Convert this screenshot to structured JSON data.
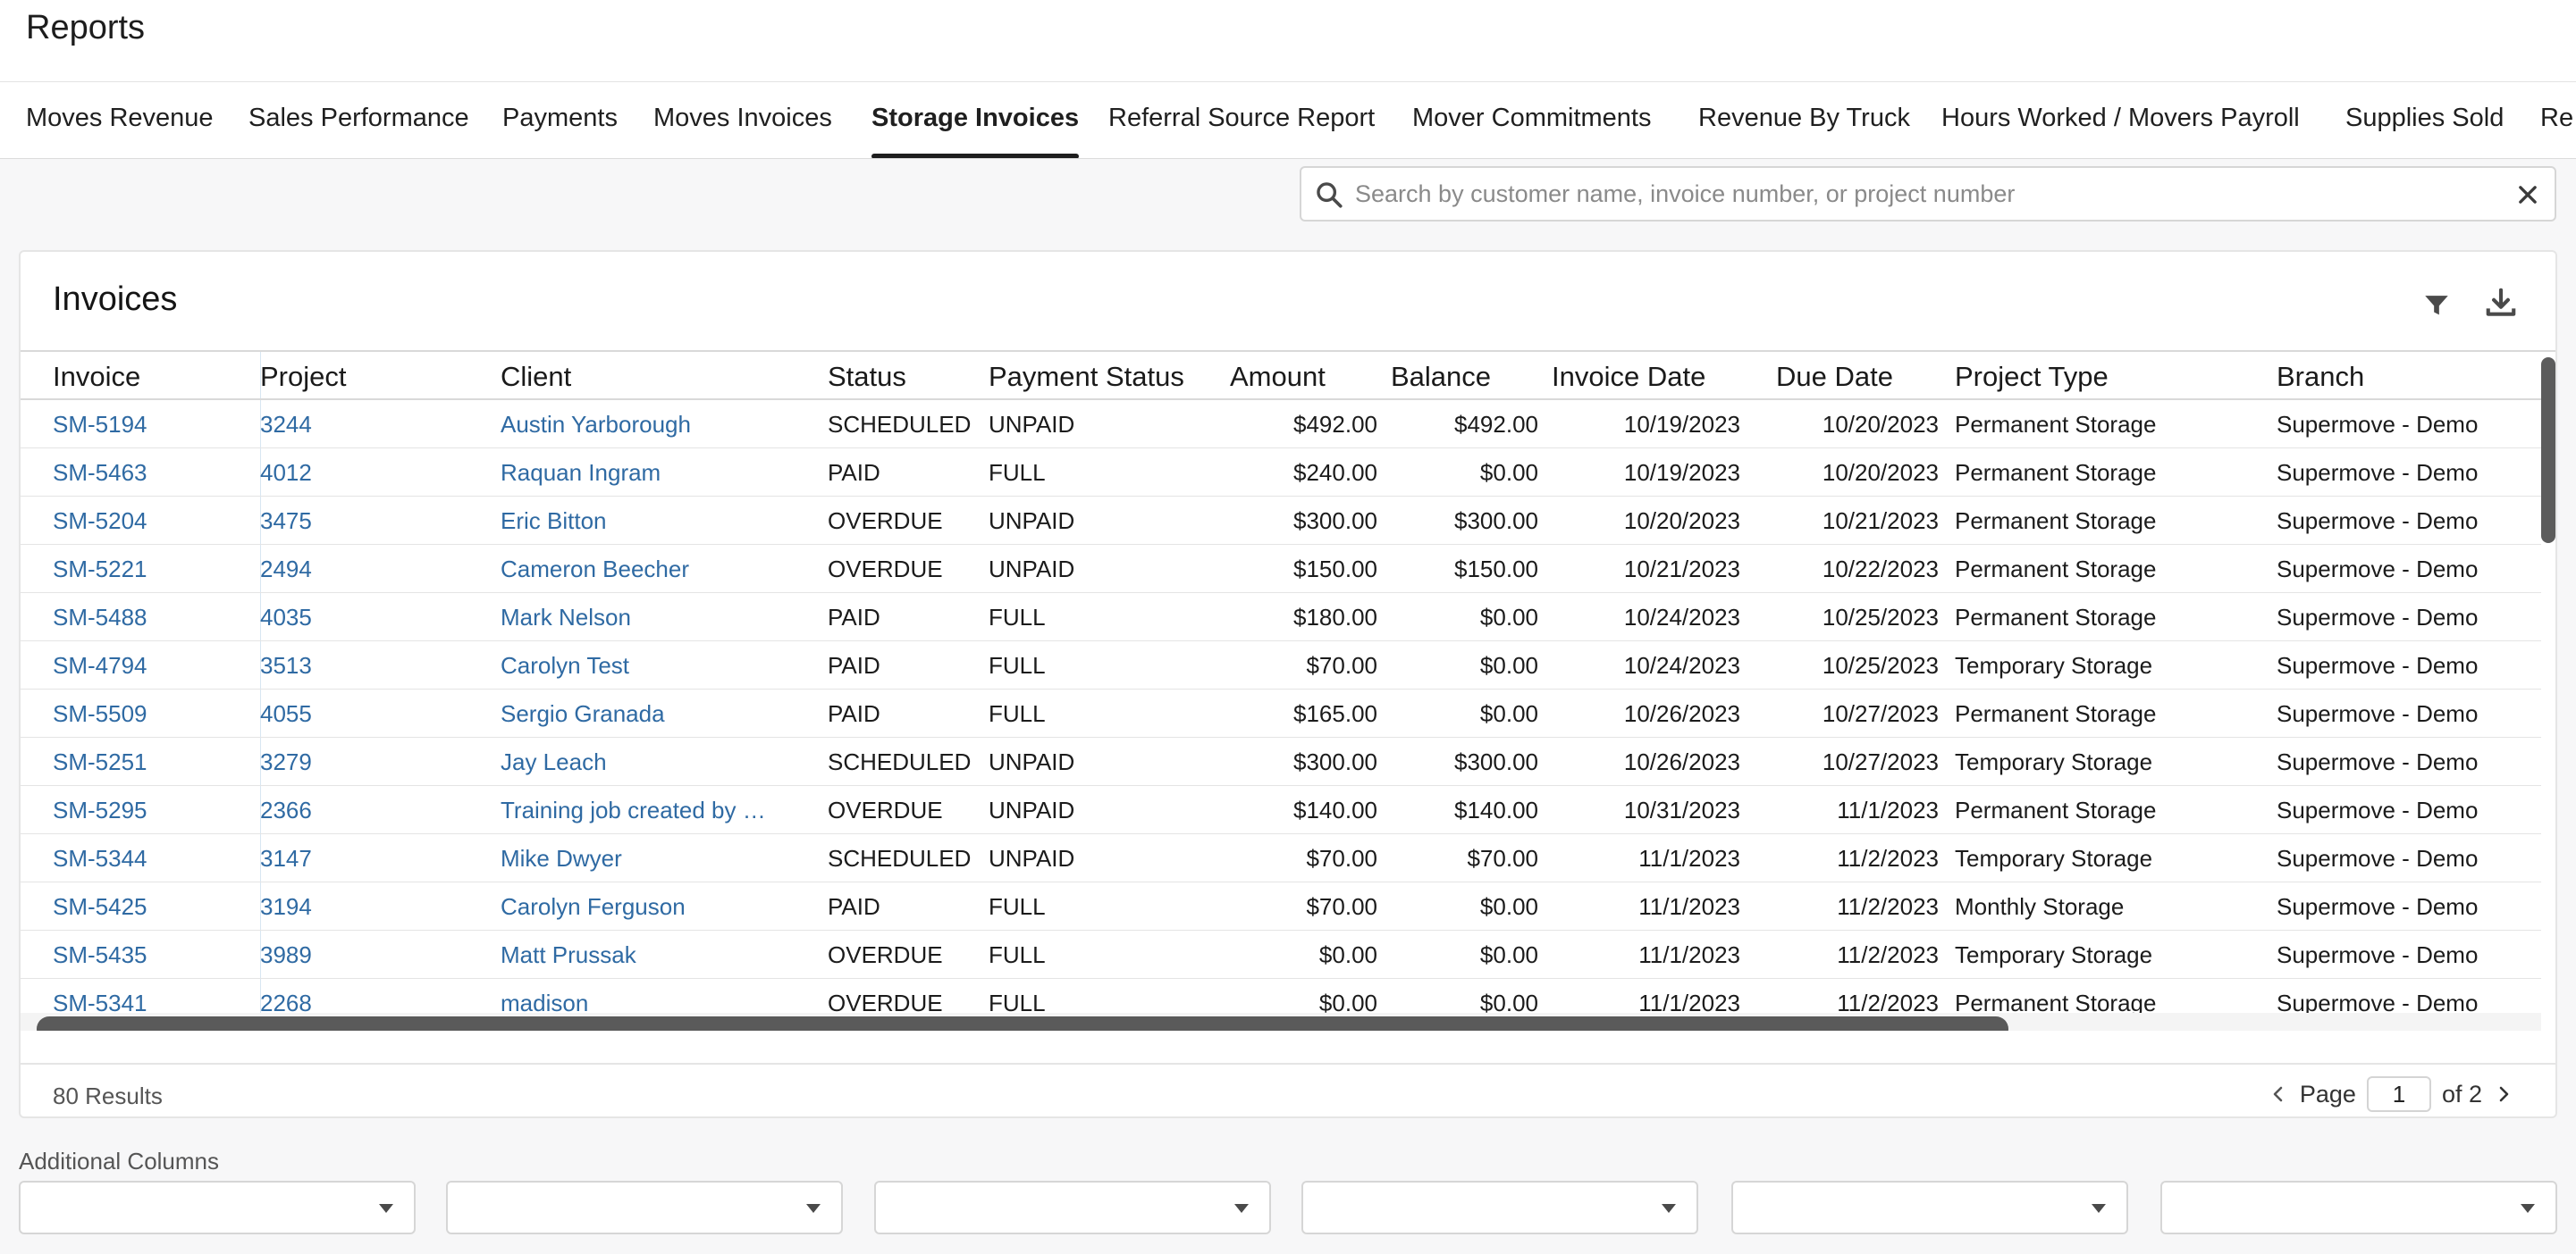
{
  "header": {
    "title": "Reports"
  },
  "tabs": [
    {
      "label": "Moves Revenue",
      "active": false
    },
    {
      "label": "Sales Performance",
      "active": false
    },
    {
      "label": "Payments",
      "active": false
    },
    {
      "label": "Moves Invoices",
      "active": false
    },
    {
      "label": "Storage Invoices",
      "active": true
    },
    {
      "label": "Referral Source Report",
      "active": false
    },
    {
      "label": "Mover Commitments",
      "active": false
    },
    {
      "label": "Revenue By Truck",
      "active": false
    },
    {
      "label": "Hours Worked / Movers Payroll",
      "active": false
    },
    {
      "label": "Supplies Sold",
      "active": false
    },
    {
      "label": "Re",
      "active": false
    }
  ],
  "search": {
    "value": "",
    "placeholder": "Search by customer name, invoice number, or project number"
  },
  "card": {
    "title": "Invoices",
    "icons": {
      "filter": "filter-icon",
      "download": "download-icon"
    }
  },
  "table": {
    "columns": [
      "Invoice",
      "Project",
      "Client",
      "Status",
      "Payment Status",
      "Amount",
      "Balance",
      "Invoice Date",
      "Due Date",
      "Project Type",
      "Branch"
    ],
    "rows": [
      [
        "SM-5194",
        "3244",
        "Austin Yarborough",
        "SCHEDULED",
        "UNPAID",
        "$492.00",
        "$492.00",
        "10/19/2023",
        "10/20/2023",
        "Permanent Storage",
        "Supermove - Demo"
      ],
      [
        "SM-5463",
        "4012",
        "Raquan Ingram",
        "PAID",
        "FULL",
        "$240.00",
        "$0.00",
        "10/19/2023",
        "10/20/2023",
        "Permanent Storage",
        "Supermove - Demo"
      ],
      [
        "SM-5204",
        "3475",
        "Eric Bitton",
        "OVERDUE",
        "UNPAID",
        "$300.00",
        "$300.00",
        "10/20/2023",
        "10/21/2023",
        "Permanent Storage",
        "Supermove - Demo"
      ],
      [
        "SM-5221",
        "2494",
        "Cameron Beecher",
        "OVERDUE",
        "UNPAID",
        "$150.00",
        "$150.00",
        "10/21/2023",
        "10/22/2023",
        "Permanent Storage",
        "Supermove - Demo"
      ],
      [
        "SM-5488",
        "4035",
        "Mark Nelson",
        "PAID",
        "FULL",
        "$180.00",
        "$0.00",
        "10/24/2023",
        "10/25/2023",
        "Permanent Storage",
        "Supermove - Demo"
      ],
      [
        "SM-4794",
        "3513",
        "Carolyn Test",
        "PAID",
        "FULL",
        "$70.00",
        "$0.00",
        "10/24/2023",
        "10/25/2023",
        "Temporary Storage",
        "Supermove - Demo"
      ],
      [
        "SM-5509",
        "4055",
        "Sergio Granada",
        "PAID",
        "FULL",
        "$165.00",
        "$0.00",
        "10/26/2023",
        "10/27/2023",
        "Permanent Storage",
        "Supermove - Demo"
      ],
      [
        "SM-5251",
        "3279",
        "Jay Leach",
        "SCHEDULED",
        "UNPAID",
        "$300.00",
        "$300.00",
        "10/26/2023",
        "10/27/2023",
        "Temporary Storage",
        "Supermove - Demo"
      ],
      [
        "SM-5295",
        "2366",
        "Training job created by …",
        "OVERDUE",
        "UNPAID",
        "$140.00",
        "$140.00",
        "10/31/2023",
        "11/1/2023",
        "Permanent Storage",
        "Supermove - Demo"
      ],
      [
        "SM-5344",
        "3147",
        "Mike Dwyer",
        "SCHEDULED",
        "UNPAID",
        "$70.00",
        "$70.00",
        "11/1/2023",
        "11/2/2023",
        "Temporary Storage",
        "Supermove - Demo"
      ],
      [
        "SM-5425",
        "3194",
        "Carolyn Ferguson",
        "PAID",
        "FULL",
        "$70.00",
        "$0.00",
        "11/1/2023",
        "11/2/2023",
        "Monthly Storage",
        "Supermove - Demo"
      ],
      [
        "SM-5435",
        "3989",
        "Matt Prussak",
        "OVERDUE",
        "FULL",
        "$0.00",
        "$0.00",
        "11/1/2023",
        "11/2/2023",
        "Temporary Storage",
        "Supermove - Demo"
      ],
      [
        "SM-5341",
        "2268",
        "madison",
        "OVERDUE",
        "FULL",
        "$0.00",
        "$0.00",
        "11/1/2023",
        "11/2/2023",
        "Permanent Storage",
        "Supermove - Demo"
      ]
    ]
  },
  "footer": {
    "results": "80 Results",
    "page_label": "Page",
    "page_value": "1",
    "of_label": "of 2"
  },
  "additional": {
    "label": "Additional Columns",
    "selects": [
      "",
      "",
      "",
      "",
      "",
      ""
    ]
  },
  "colors": {
    "link": "#2f6aa3",
    "active_tab_underline": "#1e1e1e",
    "scrollbar": "#5a5a5a"
  }
}
